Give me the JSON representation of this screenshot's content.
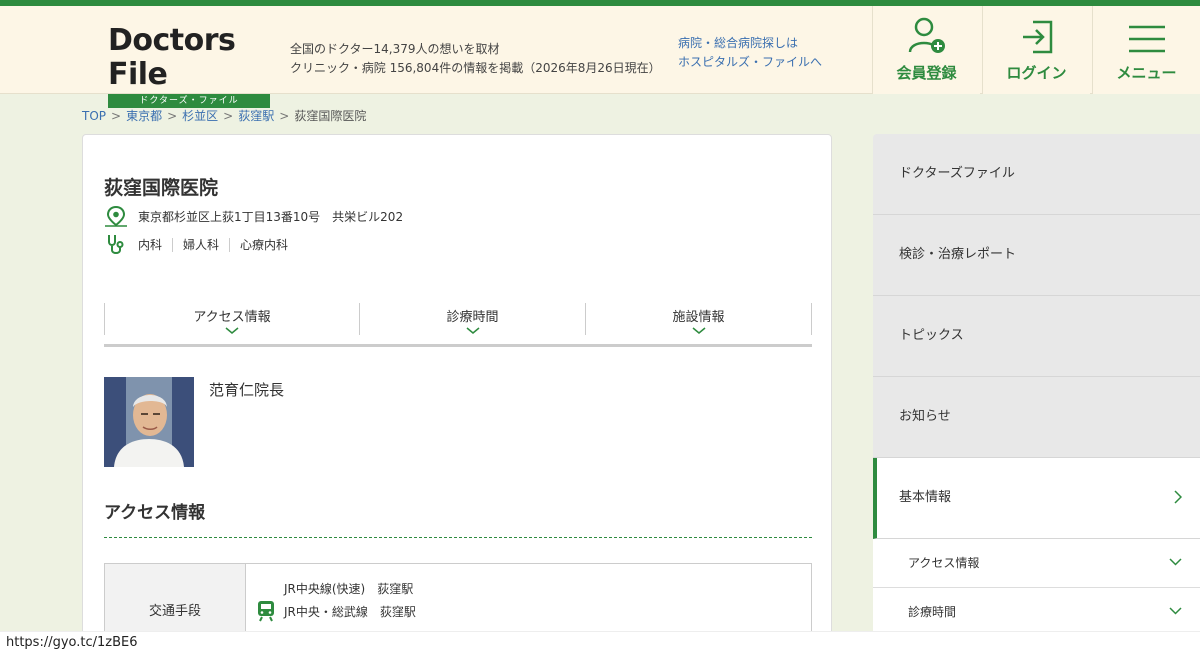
{
  "header": {
    "logo_main": "Doctors File",
    "logo_sub": "ドクターズ・ファイル",
    "tagline_1": "全国のドクター14,379人の想いを取材",
    "tagline_2": "クリニック・病院 156,804件の情報を掲載（2026年8月26日現在）",
    "hospital_link_1": "病院・総合病院探しは",
    "hospital_link_2": "ホスピタルズ・ファイルへ",
    "member_label": "会員登録",
    "login_label": "ログイン",
    "menu_label": "メニュー"
  },
  "breadcrumb": [
    "TOP",
    "東京都",
    "杉並区",
    "荻窪駅",
    "荻窪国際医院"
  ],
  "clinic": {
    "name": "荻窪国際医院",
    "address": "東京都杉並区上荻1丁目13番10号　共栄ビル202",
    "departments": [
      "内科",
      "婦人科",
      "心療内科"
    ]
  },
  "tabs": [
    "アクセス情報",
    "診療時間",
    "施設情報"
  ],
  "doctor": {
    "name": "范育仁院長"
  },
  "access": {
    "section_title": "アクセス情報",
    "header": "交通手段",
    "lines": [
      "JR中央線(快速)　荻窪駅",
      "JR中央・総武線　荻窪駅"
    ]
  },
  "sidebar": {
    "items": [
      "ドクターズファイル",
      "検診・治療レポート",
      "トピックス",
      "お知らせ",
      "基本情報"
    ],
    "sub_items": [
      "アクセス情報",
      "診療時間"
    ]
  },
  "status_url": "https://gyo.tc/1zBE6",
  "colors": {
    "brand_green": "#2e8b3f",
    "link_blue": "#3a6fb0",
    "page_bg": "#eef2e2"
  }
}
